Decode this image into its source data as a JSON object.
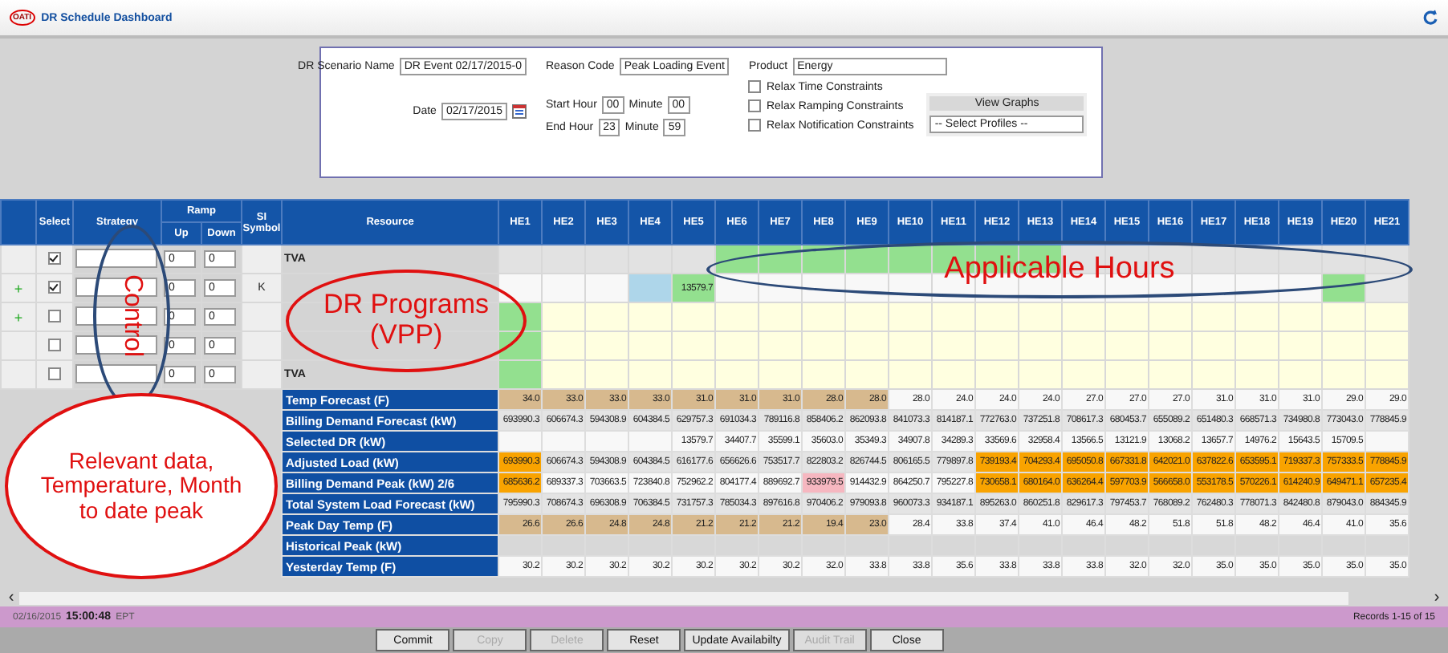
{
  "app": {
    "logo": "OATI",
    "title": "DR Schedule Dashboard"
  },
  "form": {
    "scenario_label": "DR Scenario Name",
    "scenario_value": "DR Event 02/17/2015-0",
    "reason_label": "Reason Code",
    "reason_value": "Peak Loading Event",
    "product_label": "Product",
    "product_value": "Energy",
    "date_label": "Date",
    "date_value": "02/17/2015",
    "start_hour_label": "Start Hour",
    "start_hour": "00",
    "start_minute_label": "Minute",
    "start_minute": "00",
    "end_hour_label": "End Hour",
    "end_hour": "23",
    "end_minute_label": "Minute",
    "end_minute": "59",
    "checks": [
      {
        "label": "Relax Time Constraints",
        "checked": false
      },
      {
        "label": "Relax Ramping Constraints",
        "checked": false
      },
      {
        "label": "Relax Notification Constraints",
        "checked": false
      }
    ],
    "graphs_title": "View Graphs",
    "graphs_select": "-- Select Profiles --"
  },
  "table": {
    "headers": {
      "select": "Select",
      "strategy": "Strategy",
      "ramp": "Ramp",
      "up": "Up",
      "down": "Down",
      "si": "SI Symbol",
      "resource": "Resource"
    },
    "hours": [
      "HE1",
      "HE2",
      "HE3",
      "HE4",
      "HE5",
      "HE6",
      "HE7",
      "HE8",
      "HE9",
      "HE10",
      "HE11",
      "HE12",
      "HE13",
      "HE14",
      "HE15",
      "HE16",
      "HE17",
      "HE18",
      "HE19",
      "HE20",
      "HE21"
    ],
    "resources": [
      {
        "select": true,
        "up": "0",
        "down": "0",
        "resource": "TVA",
        "hours": [
          {
            "color": "#e2e2e2"
          },
          {
            "color": "#e2e2e2"
          },
          {
            "color": "#e2e2e2"
          },
          {
            "color": "#e2e2e2"
          },
          {
            "color": "#e2e2e2"
          },
          {
            "color": "#93e08f"
          },
          {
            "color": "#93e08f"
          },
          {
            "color": "#93e08f"
          },
          {
            "color": "#93e08f"
          },
          {
            "color": "#93e08f"
          },
          {
            "color": "#93e08f"
          },
          {
            "color": "#93e08f"
          },
          {
            "color": "#93e08f"
          },
          {
            "color": "#e2e2e2"
          },
          {
            "color": "#e2e2e2"
          },
          {
            "color": "#e2e2e2"
          },
          {
            "color": "#e2e2e2"
          },
          {
            "color": "#e2e2e2"
          },
          {
            "color": "#e2e2e2"
          },
          {
            "color": "#e2e2e2"
          },
          {
            "color": "#e2e2e2"
          }
        ]
      },
      {
        "expander": "+",
        "select": true,
        "up": "0",
        "down": "0",
        "si": "K",
        "hours": [
          {
            "color": "#f8f8f8"
          },
          {
            "color": "#f8f8f8"
          },
          {
            "color": "#f8f8f8"
          },
          {
            "color": "#aed6ea"
          },
          {
            "color": "#93e08f",
            "v": "13579.7"
          },
          {
            "color": "#f8f8f8"
          },
          {
            "color": "#f8f8f8"
          },
          {
            "color": "#f8f8f8"
          },
          {
            "color": "#f8f8f8"
          },
          {
            "color": "#f8f8f8"
          },
          {
            "color": "#f8f8f8"
          },
          {
            "color": "#f8f8f8"
          },
          {
            "color": "#f8f8f8"
          },
          {
            "color": "#f8f8f8"
          },
          {
            "color": "#f8f8f8"
          },
          {
            "color": "#f8f8f8"
          },
          {
            "color": "#f8f8f8"
          },
          {
            "color": "#f8f8f8"
          },
          {
            "color": "#f8f8f8"
          },
          {
            "color": "#93e08f"
          },
          {
            "color": "#e8e8e8"
          }
        ]
      },
      {
        "expander": "+",
        "select": false,
        "up": "0",
        "down": "0",
        "hours": [
          {
            "color": "#93e08f"
          },
          {
            "color": "#ffffe0"
          },
          {
            "color": "#ffffe0"
          },
          {
            "color": "#ffffe0"
          },
          {
            "color": "#ffffe0"
          },
          {
            "color": "#ffffe0"
          },
          {
            "color": "#ffffe0"
          },
          {
            "color": "#ffffe0"
          },
          {
            "color": "#ffffe0"
          },
          {
            "color": "#ffffe0"
          },
          {
            "color": "#ffffe0"
          },
          {
            "color": "#ffffe0"
          },
          {
            "color": "#ffffe0"
          },
          {
            "color": "#ffffe0"
          },
          {
            "color": "#ffffe0"
          },
          {
            "color": "#ffffe0"
          },
          {
            "color": "#ffffe0"
          },
          {
            "color": "#ffffe0"
          },
          {
            "color": "#ffffe0"
          },
          {
            "color": "#ffffe0"
          },
          {
            "color": "#ffffe0"
          }
        ]
      },
      {
        "select": false,
        "up": "0",
        "down": "0",
        "hours": [
          {
            "color": "#93e08f"
          },
          {
            "color": "#ffffe0"
          },
          {
            "color": "#ffffe0"
          },
          {
            "color": "#ffffe0"
          },
          {
            "color": "#ffffe0"
          },
          {
            "color": "#ffffe0"
          },
          {
            "color": "#ffffe0"
          },
          {
            "color": "#ffffe0"
          },
          {
            "color": "#ffffe0"
          },
          {
            "color": "#ffffe0"
          },
          {
            "color": "#ffffe0"
          },
          {
            "color": "#ffffe0"
          },
          {
            "color": "#ffffe0"
          },
          {
            "color": "#ffffe0"
          },
          {
            "color": "#ffffe0"
          },
          {
            "color": "#ffffe0"
          },
          {
            "color": "#ffffe0"
          },
          {
            "color": "#ffffe0"
          },
          {
            "color": "#ffffe0"
          },
          {
            "color": "#ffffe0"
          },
          {
            "color": "#ffffe0"
          }
        ]
      },
      {
        "select": false,
        "up": "0",
        "down": "0",
        "resource": "TVA",
        "hours": [
          {
            "color": "#93e08f"
          },
          {
            "color": "#ffffe0"
          },
          {
            "color": "#ffffe0"
          },
          {
            "color": "#ffffe0"
          },
          {
            "color": "#ffffe0"
          },
          {
            "color": "#ffffe0"
          },
          {
            "color": "#ffffe0"
          },
          {
            "color": "#ffffe0"
          },
          {
            "color": "#ffffe0"
          },
          {
            "color": "#ffffe0"
          },
          {
            "color": "#ffffe0"
          },
          {
            "color": "#ffffe0"
          },
          {
            "color": "#ffffe0"
          },
          {
            "color": "#ffffe0"
          },
          {
            "color": "#ffffe0"
          },
          {
            "color": "#ffffe0"
          },
          {
            "color": "#ffffe0"
          },
          {
            "color": "#ffffe0"
          },
          {
            "color": "#ffffe0"
          },
          {
            "color": "#ffffe0"
          },
          {
            "color": "#ffffe0"
          }
        ]
      }
    ],
    "data_rows": [
      {
        "label": "Temp Forecast (F)",
        "color": "#f8f8f8",
        "cells": [
          {
            "v": "34.0",
            "color": "#d7b98e"
          },
          {
            "v": "33.0",
            "color": "#d7b98e"
          },
          {
            "v": "33.0",
            "color": "#d7b98e"
          },
          {
            "v": "33.0",
            "color": "#d7b98e"
          },
          {
            "v": "31.0",
            "color": "#d7b98e"
          },
          {
            "v": "31.0",
            "color": "#d7b98e"
          },
          {
            "v": "31.0",
            "color": "#d7b98e"
          },
          {
            "v": "28.0",
            "color": "#d7b98e"
          },
          {
            "v": "28.0",
            "color": "#d7b98e"
          },
          {
            "v": "28.0"
          },
          {
            "v": "24.0"
          },
          {
            "v": "24.0"
          },
          {
            "v": "24.0"
          },
          {
            "v": "27.0"
          },
          {
            "v": "27.0"
          },
          {
            "v": "27.0"
          },
          {
            "v": "31.0"
          },
          {
            "v": "31.0"
          },
          {
            "v": "31.0"
          },
          {
            "v": "29.0"
          },
          {
            "v": "29.0"
          }
        ]
      },
      {
        "label": "Billing Demand Forecast (kW)",
        "color": "#e4e4e4",
        "cells": [
          {
            "v": "693990.3"
          },
          {
            "v": "606674.3"
          },
          {
            "v": "594308.9"
          },
          {
            "v": "604384.5"
          },
          {
            "v": "629757.3"
          },
          {
            "v": "691034.3"
          },
          {
            "v": "789116.8"
          },
          {
            "v": "858406.2"
          },
          {
            "v": "862093.8"
          },
          {
            "v": "841073.3"
          },
          {
            "v": "814187.1"
          },
          {
            "v": "772763.0"
          },
          {
            "v": "737251.8"
          },
          {
            "v": "708617.3"
          },
          {
            "v": "680453.7"
          },
          {
            "v": "655089.2"
          },
          {
            "v": "651480.3"
          },
          {
            "v": "668571.3"
          },
          {
            "v": "734980.8"
          },
          {
            "v": "773043.0"
          },
          {
            "v": "778845.9"
          }
        ]
      },
      {
        "label": "Selected DR (kW)",
        "color": "#f8f8f8",
        "cells": [
          {
            "color": "#f8f8f8"
          },
          {
            "color": "#f8f8f8"
          },
          {
            "color": "#f8f8f8"
          },
          {
            "color": "#f8f8f8"
          },
          {
            "v": "13579.7"
          },
          {
            "v": "34407.7"
          },
          {
            "v": "35599.1"
          },
          {
            "v": "35603.0"
          },
          {
            "v": "35349.3"
          },
          {
            "v": "34907.8"
          },
          {
            "v": "34289.3"
          },
          {
            "v": "33569.6"
          },
          {
            "v": "32958.4"
          },
          {
            "v": "13566.5"
          },
          {
            "v": "13121.9"
          },
          {
            "v": "13068.2"
          },
          {
            "v": "13657.7"
          },
          {
            "v": "14976.2"
          },
          {
            "v": "15643.5"
          },
          {
            "v": "15709.5"
          },
          {
            "color": "#f8f8f8"
          }
        ]
      },
      {
        "label": "Adjusted Load (kW)",
        "color": "#e4e4e4",
        "cells": [
          {
            "v": "693990.3",
            "color": "#f9a300"
          },
          {
            "v": "606674.3"
          },
          {
            "v": "594308.9"
          },
          {
            "v": "604384.5"
          },
          {
            "v": "616177.6"
          },
          {
            "v": "656626.6"
          },
          {
            "v": "753517.7"
          },
          {
            "v": "822803.2"
          },
          {
            "v": "826744.5"
          },
          {
            "v": "806165.5"
          },
          {
            "v": "779897.8"
          },
          {
            "v": "739193.4",
            "color": "#f9a300"
          },
          {
            "v": "704293.4",
            "color": "#f9a300"
          },
          {
            "v": "695050.8",
            "color": "#f9a300"
          },
          {
            "v": "667331.8",
            "color": "#f9a300"
          },
          {
            "v": "642021.0",
            "color": "#f9a300"
          },
          {
            "v": "637822.6",
            "color": "#f9a300"
          },
          {
            "v": "653595.1",
            "color": "#f9a300"
          },
          {
            "v": "719337.3",
            "color": "#f9a300"
          },
          {
            "v": "757333.5",
            "color": "#f9a300"
          },
          {
            "v": "778845.9",
            "color": "#f9a300"
          }
        ]
      },
      {
        "label": "Billing Demand Peak (kW) 2/6",
        "color": "#f8f8f8",
        "cells": [
          {
            "v": "685636.2",
            "color": "#f9a300"
          },
          {
            "v": "689337.3"
          },
          {
            "v": "703663.5"
          },
          {
            "v": "723840.8"
          },
          {
            "v": "752962.2"
          },
          {
            "v": "804177.4"
          },
          {
            "v": "889692.7"
          },
          {
            "v": "933979.5",
            "color": "#f6b7c0"
          },
          {
            "v": "914432.9"
          },
          {
            "v": "864250.7"
          },
          {
            "v": "795227.8"
          },
          {
            "v": "730658.1",
            "color": "#f9a300"
          },
          {
            "v": "680164.0",
            "color": "#f9a300"
          },
          {
            "v": "636264.4",
            "color": "#f9a300"
          },
          {
            "v": "597703.9",
            "color": "#f9a300"
          },
          {
            "v": "566658.0",
            "color": "#f9a300"
          },
          {
            "v": "553178.5",
            "color": "#f9a300"
          },
          {
            "v": "570226.1",
            "color": "#f9a300"
          },
          {
            "v": "614240.9",
            "color": "#f9a300"
          },
          {
            "v": "649471.1",
            "color": "#f9a300"
          },
          {
            "v": "657235.4",
            "color": "#f9a300"
          }
        ]
      },
      {
        "label": "Total System Load Forecast (kW)",
        "color": "#e4e4e4",
        "cells": [
          {
            "v": "795990.3"
          },
          {
            "v": "708674.3"
          },
          {
            "v": "696308.9"
          },
          {
            "v": "706384.5"
          },
          {
            "v": "731757.3"
          },
          {
            "v": "785034.3"
          },
          {
            "v": "897616.8"
          },
          {
            "v": "970406.2"
          },
          {
            "v": "979093.8"
          },
          {
            "v": "960073.3"
          },
          {
            "v": "934187.1"
          },
          {
            "v": "895263.0"
          },
          {
            "v": "860251.8"
          },
          {
            "v": "829617.3"
          },
          {
            "v": "797453.7"
          },
          {
            "v": "768089.2"
          },
          {
            "v": "762480.3"
          },
          {
            "v": "778071.3"
          },
          {
            "v": "842480.8"
          },
          {
            "v": "879043.0"
          },
          {
            "v": "884345.9"
          }
        ]
      },
      {
        "label": "Peak Day Temp (F)",
        "color": "#f8f8f8",
        "cells": [
          {
            "v": "26.6",
            "color": "#d7b98e"
          },
          {
            "v": "26.6",
            "color": "#d7b98e"
          },
          {
            "v": "24.8",
            "color": "#d7b98e"
          },
          {
            "v": "24.8",
            "color": "#d7b98e"
          },
          {
            "v": "21.2",
            "color": "#d7b98e"
          },
          {
            "v": "21.2",
            "color": "#d7b98e"
          },
          {
            "v": "21.2",
            "color": "#d7b98e"
          },
          {
            "v": "19.4",
            "color": "#d7b98e"
          },
          {
            "v": "23.0",
            "color": "#d7b98e"
          },
          {
            "v": "28.4"
          },
          {
            "v": "33.8"
          },
          {
            "v": "37.4"
          },
          {
            "v": "41.0"
          },
          {
            "v": "46.4"
          },
          {
            "v": "48.2"
          },
          {
            "v": "51.8"
          },
          {
            "v": "51.8"
          },
          {
            "v": "48.2"
          },
          {
            "v": "46.4"
          },
          {
            "v": "41.0"
          },
          {
            "v": "35.6"
          }
        ]
      },
      {
        "label": "Historical Peak (kW)",
        "cells": [
          {
            "color": "#d8d8d8"
          },
          {
            "color": "#d8d8d8"
          },
          {
            "color": "#d8d8d8"
          },
          {
            "color": "#d8d8d8"
          },
          {
            "color": "#d8d8d8"
          },
          {
            "color": "#d8d8d8"
          },
          {
            "color": "#d8d8d8"
          },
          {
            "color": "#d8d8d8"
          },
          {
            "color": "#d8d8d8"
          },
          {
            "color": "#d8d8d8"
          },
          {
            "color": "#d8d8d8"
          },
          {
            "color": "#d8d8d8"
          },
          {
            "color": "#d8d8d8"
          },
          {
            "color": "#d8d8d8"
          },
          {
            "color": "#d8d8d8"
          },
          {
            "color": "#d8d8d8"
          },
          {
            "color": "#d8d8d8"
          },
          {
            "color": "#d8d8d8"
          },
          {
            "color": "#d8d8d8"
          },
          {
            "color": "#d8d8d8"
          },
          {
            "color": "#d8d8d8"
          }
        ]
      },
      {
        "label": "Yesterday Temp (F)",
        "color": "#f8f8f8",
        "cells": [
          {
            "v": "30.2"
          },
          {
            "v": "30.2"
          },
          {
            "v": "30.2"
          },
          {
            "v": "30.2"
          },
          {
            "v": "30.2"
          },
          {
            "v": "30.2"
          },
          {
            "v": "30.2"
          },
          {
            "v": "32.0"
          },
          {
            "v": "33.8"
          },
          {
            "v": "33.8"
          },
          {
            "v": "35.6"
          },
          {
            "v": "33.8"
          },
          {
            "v": "33.8"
          },
          {
            "v": "33.8"
          },
          {
            "v": "32.0"
          },
          {
            "v": "32.0"
          },
          {
            "v": "35.0"
          },
          {
            "v": "35.0"
          },
          {
            "v": "35.0"
          },
          {
            "v": "35.0"
          },
          {
            "v": "35.0"
          }
        ]
      }
    ]
  },
  "scrollbar": {
    "left": "‹",
    "right": "›"
  },
  "status_bar": {
    "date": "02/16/2015",
    "time": "15:00:48",
    "zone": "EPT",
    "records": "Records 1-15 of 15"
  },
  "buttons": [
    {
      "label": "Commit",
      "disabled": false
    },
    {
      "label": "Copy",
      "disabled": true
    },
    {
      "label": "Delete",
      "disabled": true
    },
    {
      "label": "Reset",
      "disabled": false
    },
    {
      "label": "Update Availabilty",
      "disabled": false
    },
    {
      "label": "Audit Trail",
      "disabled": true
    },
    {
      "label": "Close",
      "disabled": false
    }
  ],
  "annotations": [
    {
      "text": "Control",
      "kind": "vertical",
      "color": "#2c4a78"
    },
    {
      "text": "DR Programs (VPP)",
      "kind": "horizontal",
      "color": "#e01010"
    },
    {
      "text": "Applicable Hours",
      "kind": "horizontal",
      "color": "#2c4a78"
    },
    {
      "text": "Relevant data, Temperature, Month to date peak",
      "kind": "horizontal",
      "color": "#e01010"
    }
  ]
}
